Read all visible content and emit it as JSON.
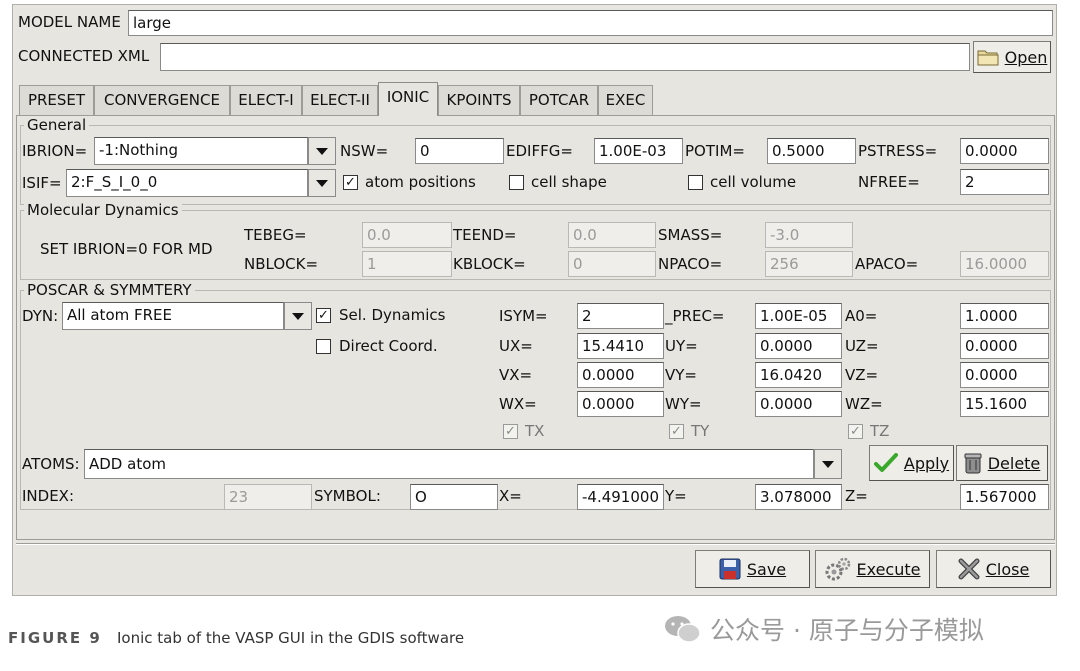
{
  "window": {
    "model_name_label": "MODEL NAME",
    "model_name_value": "large",
    "connected_xml_label": "CONNECTED XML",
    "connected_xml_value": "",
    "open_button": "Open"
  },
  "tabs": [
    {
      "label": "PRESET"
    },
    {
      "label": "CONVERGENCE"
    },
    {
      "label": "ELECT-I"
    },
    {
      "label": "ELECT-II"
    },
    {
      "label": "IONIC",
      "active": true
    },
    {
      "label": "KPOINTS"
    },
    {
      "label": "POTCAR"
    },
    {
      "label": "EXEC"
    }
  ],
  "general": {
    "title": "General",
    "ibrion_label": "IBRION=",
    "ibrion_value": "-1:Nothing",
    "nsw_label": "NSW=",
    "nsw_value": "0",
    "ediffg_label": "EDIFFG=",
    "ediffg_value": "1.00E-03",
    "potim_label": "POTIM=",
    "potim_value": "0.5000",
    "pstress_label": "PSTRESS=",
    "pstress_value": "0.0000",
    "isif_label": "ISIF=",
    "isif_value": "2:F_S_I_0_0",
    "atom_positions_label": "atom positions",
    "atom_positions_checked": true,
    "cell_shape_label": "cell shape",
    "cell_shape_checked": false,
    "cell_volume_label": "cell volume",
    "cell_volume_checked": false,
    "nfree_label": "NFREE=",
    "nfree_value": "2"
  },
  "md": {
    "title": "Molecular Dynamics",
    "note": "SET IBRION=0 FOR MD",
    "tebeg_label": "TEBEG=",
    "tebeg_value": "0.0",
    "teend_label": "TEEND=",
    "teend_value": "0.0",
    "smass_label": "SMASS=",
    "smass_value": "-3.0",
    "nblock_label": "NBLOCK=",
    "nblock_value": "1",
    "kblock_label": "KBLOCK=",
    "kblock_value": "0",
    "npaco_label": "NPACO=",
    "npaco_value": "256",
    "apaco_label": "APACO=",
    "apaco_value": "16.0000"
  },
  "poscar": {
    "title": "POSCAR & SYMMTERY",
    "dyn_label": "DYN:",
    "dyn_value": "All atom FREE",
    "sel_dyn_label": "Sel. Dynamics",
    "sel_dyn_checked": true,
    "direct_label": "Direct Coord.",
    "direct_checked": false,
    "isym_label": "ISYM=",
    "isym_value": "2",
    "prec_label": "_PREC=",
    "prec_value": "1.00E-05",
    "a0_label": "A0=",
    "a0_value": "1.0000",
    "ux_label": "UX=",
    "ux_value": "15.4410",
    "uy_label": "UY=",
    "uy_value": "0.0000",
    "uz_label": "UZ=",
    "uz_value": "0.0000",
    "vx_label": "VX=",
    "vx_value": "0.0000",
    "vy_label": "VY=",
    "vy_value": "16.0420",
    "vz_label": "VZ=",
    "vz_value": "0.0000",
    "wx_label": "WX=",
    "wx_value": "0.0000",
    "wy_label": "WY=",
    "wy_value": "0.0000",
    "wz_label": "WZ=",
    "wz_value": "15.1600",
    "tx_label": "TX",
    "ty_label": "TY",
    "tz_label": "TZ",
    "atoms_label": "ATOMS:",
    "atoms_value": "ADD atom",
    "apply_button": "Apply",
    "delete_button": "Delete",
    "index_label": "INDEX:",
    "index_value": "23",
    "symbol_label": "SYMBOL:",
    "symbol_value": "O",
    "x_label": "X=",
    "x_value": "-4.491000",
    "y_label": "Y=",
    "y_value": "3.078000",
    "z_label": "Z=",
    "z_value": "1.567000"
  },
  "footer_buttons": {
    "save": "Save",
    "execute": "Execute",
    "close": "Close"
  },
  "caption": {
    "figure": "FIGURE 9",
    "text": "Ionic tab of the VASP GUI in the GDIS software",
    "watermark": "公众号 · 原子与分子模拟"
  },
  "colors": {
    "window_bg": "#e6e5e0",
    "input_bg": "#ffffff",
    "disabled_bg": "#efeeea",
    "apply_icon": "#3aa82a"
  }
}
